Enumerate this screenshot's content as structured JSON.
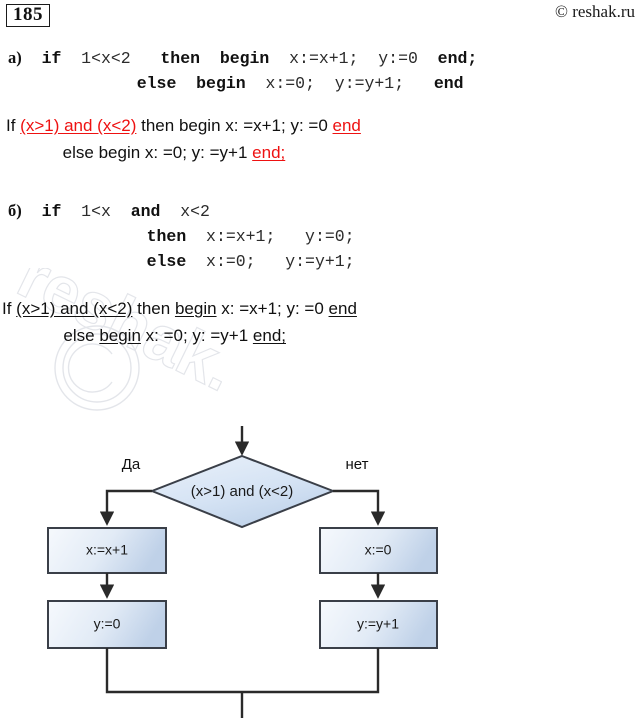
{
  "header": {
    "exercise_number": "185",
    "copyright": "© reshak.ru"
  },
  "watermark": {
    "text": "reshak.ru",
    "symbol": "©"
  },
  "tasks": [
    {
      "id": "a",
      "label": "a)",
      "code_lines": [
        "a)  if  1<x<2   then  begin  x:=x+1;  y:=0  end;",
        "             else  begin  x:=0;  y:=y+1;   end"
      ]
    },
    {
      "id": "b",
      "label": "б)",
      "code_lines": [
        "б)  if  1<x  and  x<2",
        "             then  x:=x+1;   y:=0;",
        "             else  x:=0;   y:=y+1;"
      ]
    }
  ],
  "answers": {
    "a": {
      "line1": {
        "p1": "If ",
        "cond": "(x>1) and (x<2)",
        "p2": " then begin x: =x+1; y: =0 ",
        "end": "end"
      },
      "line2": {
        "p1": "            else begin x: =0; y: =y+1 ",
        "end": "end;"
      }
    },
    "b": {
      "line1": {
        "p1": "If ",
        "cond": "(x>1) and (x<2)",
        "p2": " then ",
        "begin": "begin",
        "p3": " x: =x+1; y: =0 ",
        "end": "end"
      },
      "line2": {
        "p1": "             else ",
        "begin": "begin",
        "p2": " x: =0; y: =y+1 ",
        "end": "end;"
      }
    }
  },
  "flowchart": {
    "condition": "(x>1) and (x<2)",
    "yes_label": "Да",
    "no_label": "нет",
    "yes_branch": [
      "x:=x+1",
      "y:=0"
    ],
    "no_branch": [
      "x:=0",
      "y:=y+1"
    ],
    "colors": {
      "box_fill_light": "#f3f7fc",
      "box_fill_dark": "#c2d3e8",
      "stroke": "#3a3f48",
      "connector": "#2a2a2a"
    }
  }
}
